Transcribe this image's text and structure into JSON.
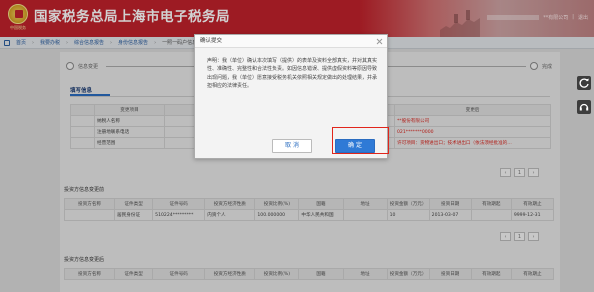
{
  "header": {
    "title": "国家税务总局上海市电子税务局",
    "emblem_caption": "中国税务",
    "user_company": "**有限公司",
    "user_sep": "|",
    "logout": "退出"
  },
  "breadcrumb": {
    "items": [
      "首页",
      "我要办税",
      "综合信息报告",
      "身份信息报告",
      "一照一码户信息变更【业务版】"
    ]
  },
  "steps": {
    "items": [
      "信息变更",
      "完成"
    ]
  },
  "section": {
    "tab": "填写信息"
  },
  "change_table": {
    "headers": [
      "",
      "变更项目",
      "",
      "变更前",
      "变更后"
    ],
    "rows": [
      [
        "",
        "纳税人名称",
        "",
        "",
        "**股份有限公司"
      ],
      [
        "",
        "注册地联系电话",
        "",
        "021*******",
        "021*******0000"
      ],
      [
        "",
        "经营范围",
        "",
        "财务咨询，软件开发，机械设备及配件，电子产品，机电设…",
        "许可项目：货物进出口；技术进出口（依法须经批准的…"
      ]
    ]
  },
  "investor_title": "投资方信息变更前",
  "investor_headers": [
    "投资方名称",
    "证件类型",
    "证件号码",
    "投资方经济性质",
    "投资比例(%)",
    "国籍",
    "地址",
    "投资金额（万元）",
    "投资日期",
    "有效期起",
    "有效期止"
  ],
  "investor_rows": [
    [
      "",
      "居民身份证",
      "510224*********",
      "内资个人",
      "100.000000",
      "中华人民共和国",
      "",
      "10",
      "2013-03-07",
      "",
      "9999-12-31"
    ]
  ],
  "investor_after_title": "投资方信息变更后",
  "pager": {
    "prev": "‹",
    "page": "1",
    "next": "›"
  },
  "modal": {
    "title": "确认提交",
    "text": "声明：我（单位）确认本次填写（提供）的表单及资料全部真实，并对其真实性、准确性、完整性和合法性负责。如因信息错误、提供虚假资料等原因导致出现问题，我（单位）愿意接受税务机关依照相关规定做出的处理结果，并承担相应的法律责任。",
    "cancel": "取 消",
    "confirm": "确 定"
  },
  "colors": {
    "brand_red": "#c0222b",
    "accent_blue": "#2f7ad6",
    "highlight_red": "#e1251b"
  },
  "icons": {
    "home": "home-icon",
    "refresh": "refresh-icon",
    "headset": "headset-icon",
    "close": "close-icon"
  }
}
